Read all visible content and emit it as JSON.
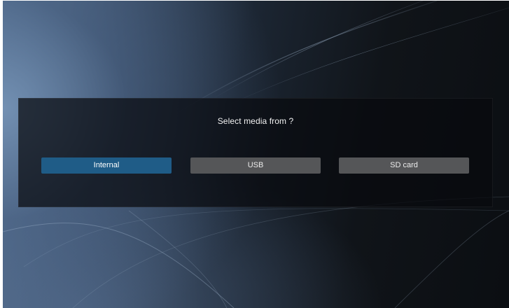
{
  "dialog": {
    "title": "Select media from ?",
    "options": [
      {
        "label": "Internal",
        "selected": true
      },
      {
        "label": "USB",
        "selected": false
      },
      {
        "label": "SD card",
        "selected": false
      }
    ]
  },
  "colors": {
    "selected_option": "#1f5c87",
    "unselected_option": "#555658",
    "dialog_background": "#080a0e"
  }
}
